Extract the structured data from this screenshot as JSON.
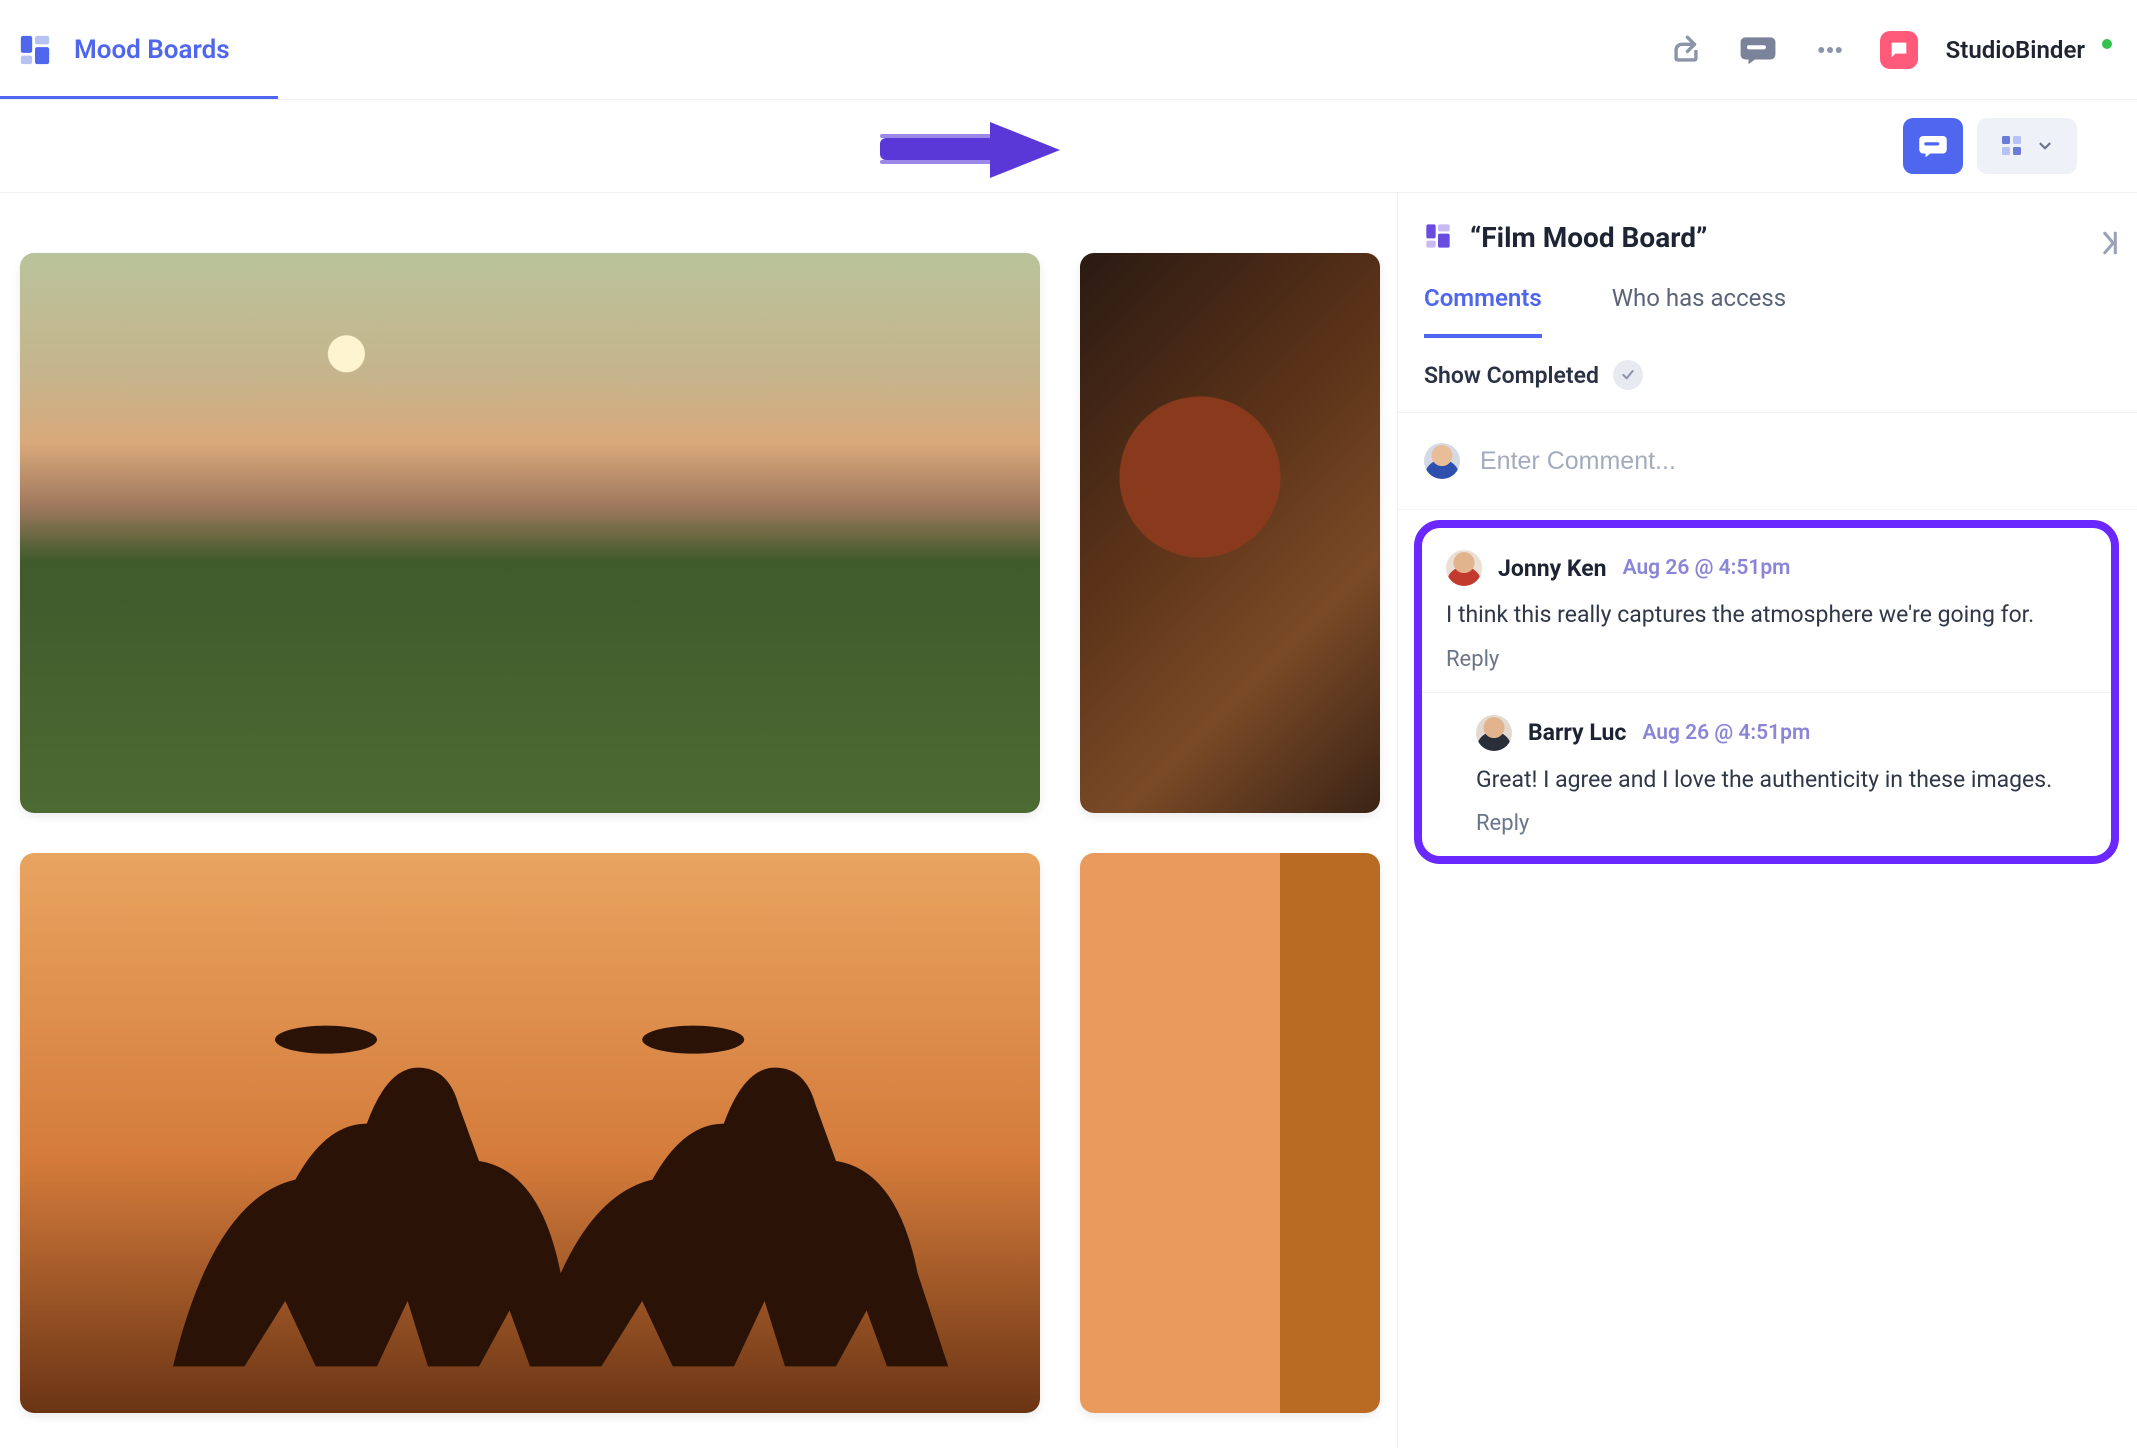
{
  "header": {
    "page_title": "Mood Boards",
    "brand_name": "StudioBinder"
  },
  "sidebar": {
    "title": "“Film Mood Board”",
    "tabs": {
      "comments": "Comments",
      "access": "Who has access"
    },
    "show_completed_label": "Show Completed",
    "input_placeholder": "Enter Comment...",
    "reply_label": "Reply",
    "comments": [
      {
        "author": "Jonny Ken",
        "time": "Aug 26 @ 4:51pm",
        "body": "I think this really captures the atmosphere we're going for."
      },
      {
        "author": "Barry Luc",
        "time": "Aug 26 @ 4:51pm",
        "body": "Great! I agree and I love the authenticity in these images."
      }
    ]
  }
}
